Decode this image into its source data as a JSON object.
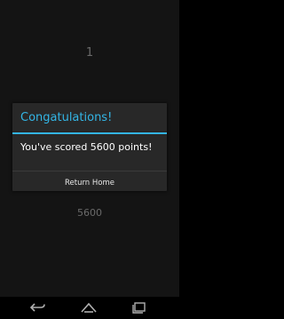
{
  "game": {
    "level_number": "1",
    "score_display": "5600"
  },
  "dialog": {
    "title": "Congatulations!",
    "message": "You've scored 5600 points!",
    "button_label": "Return Home"
  },
  "navigation": {
    "back_icon": "back-icon",
    "home_icon": "home-icon",
    "recent_apps_icon": "recent-apps-icon"
  },
  "colors": {
    "accent": "#33b5e5",
    "dialog_background": "#282828",
    "screen_background": "#141414"
  }
}
